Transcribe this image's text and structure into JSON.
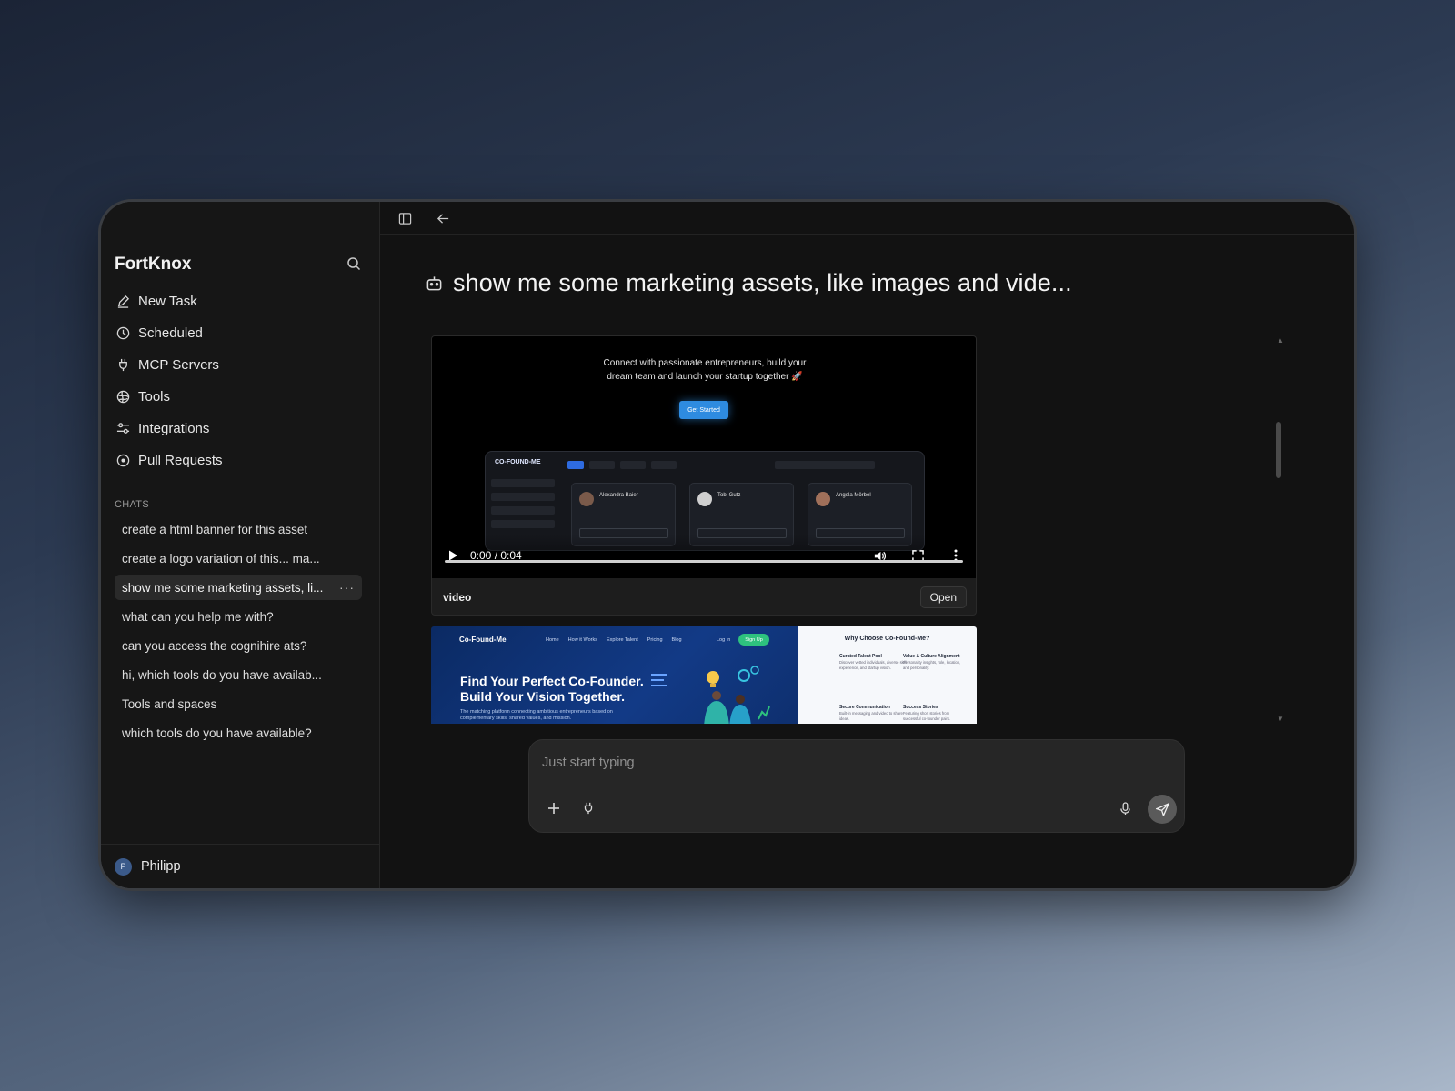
{
  "app": {
    "name": "FortKnox"
  },
  "nav": [
    {
      "label": "New Task",
      "icon": "pencil-icon"
    },
    {
      "label": "Scheduled",
      "icon": "clock-icon"
    },
    {
      "label": "MCP Servers",
      "icon": "plug-icon"
    },
    {
      "label": "Tools",
      "icon": "globe-icon"
    },
    {
      "label": "Integrations",
      "icon": "sliders-icon"
    },
    {
      "label": "Pull Requests",
      "icon": "circle-dot-icon"
    }
  ],
  "chats": {
    "heading": "CHATS",
    "items": [
      "create a html banner for this asset",
      "create a logo variation of this... ma...",
      "show me some marketing assets, li...",
      "what can you help me with?",
      "can you access the cognihire ats?",
      "hi, which tools do you have availab...",
      "Tools and spaces",
      "which tools do you have available?"
    ],
    "active_index": 2,
    "more_glyph": "···"
  },
  "user": {
    "name": "Philipp",
    "initial": "P"
  },
  "chat": {
    "title": "show me some marketing assets, like images and vide..."
  },
  "video_asset": {
    "headline_line1": "Connect with passionate entrepreneurs, build your",
    "headline_line2": "dream team and launch your startup together 🚀",
    "cta": "Get Started",
    "dashboard_logo": "CO-FOUND-ME",
    "profiles": [
      "Alexandra Baier",
      "Tobi Gutz",
      "Angela Mörbel"
    ],
    "time_display": "0:00 / 0:04",
    "progress": 0.0,
    "label": "video",
    "open_label": "Open"
  },
  "image_asset": {
    "logo": "Co-Found-Me",
    "nav": [
      "Home",
      "How it Works",
      "Explore Talent",
      "Pricing",
      "Blog"
    ],
    "login": "Log In",
    "signup": "Sign Up",
    "headline_line1": "Find Your Perfect Co-Founder.",
    "headline_line2": "Build Your Vision Together.",
    "subtext": "The matching platform connecting ambitious entrepreneurs based on complementary skills, shared values, and mission.",
    "features_title": "Why Choose Co-Found-Me?",
    "features": [
      {
        "title": "Curated Talent Pool",
        "text": "Discover vetted individuals, diverse skill experience, and startup vision."
      },
      {
        "title": "Value & Culture Alignment",
        "text": "Personality insights, role, location, and personality."
      },
      {
        "title": "Secure Communication",
        "text": "Built-in messaging and video to share ideas."
      },
      {
        "title": "Success Stories",
        "text": "Featuring short stories from successful co-founder pairs."
      }
    ]
  },
  "composer": {
    "placeholder": "Just start typing"
  },
  "colors": {
    "window_bg": "#121212",
    "sidebar_bg": "#161616",
    "active_chat": "#2a2a2a",
    "cta_blue": "#2e8be0",
    "signup_green": "#2ec27e"
  }
}
